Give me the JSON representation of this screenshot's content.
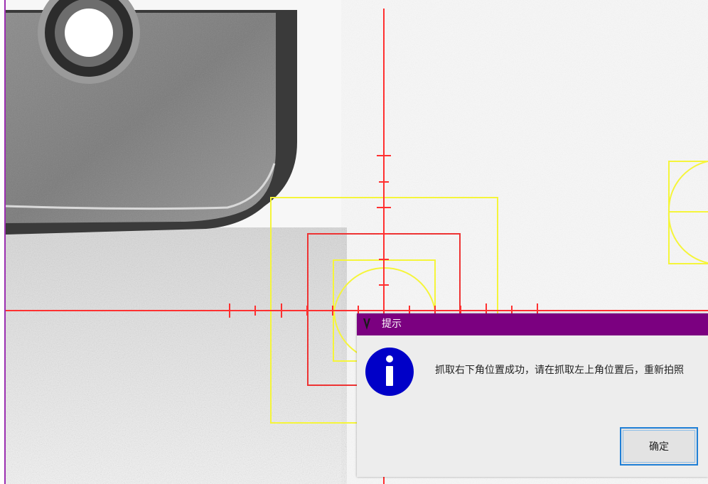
{
  "dialog": {
    "title": "提示",
    "message": "抓取右下角位置成功，请在抓取左上角位置后，重新拍照",
    "ok_label": "确定",
    "icon": "info-icon",
    "app_icon": "app-v-logo-icon"
  },
  "colors": {
    "titlebar": "#7b0080",
    "crosshair": "#ff3030",
    "roi_yellow": "#ffff30",
    "info_icon": "#0000c8",
    "ok_border": "#1f7fd6",
    "dialog_bg": "#ededed"
  },
  "image_view": {
    "content": "camera-image-part-corner",
    "overlays": [
      "crosshair",
      "roi-rectangles",
      "arc-templates"
    ]
  }
}
